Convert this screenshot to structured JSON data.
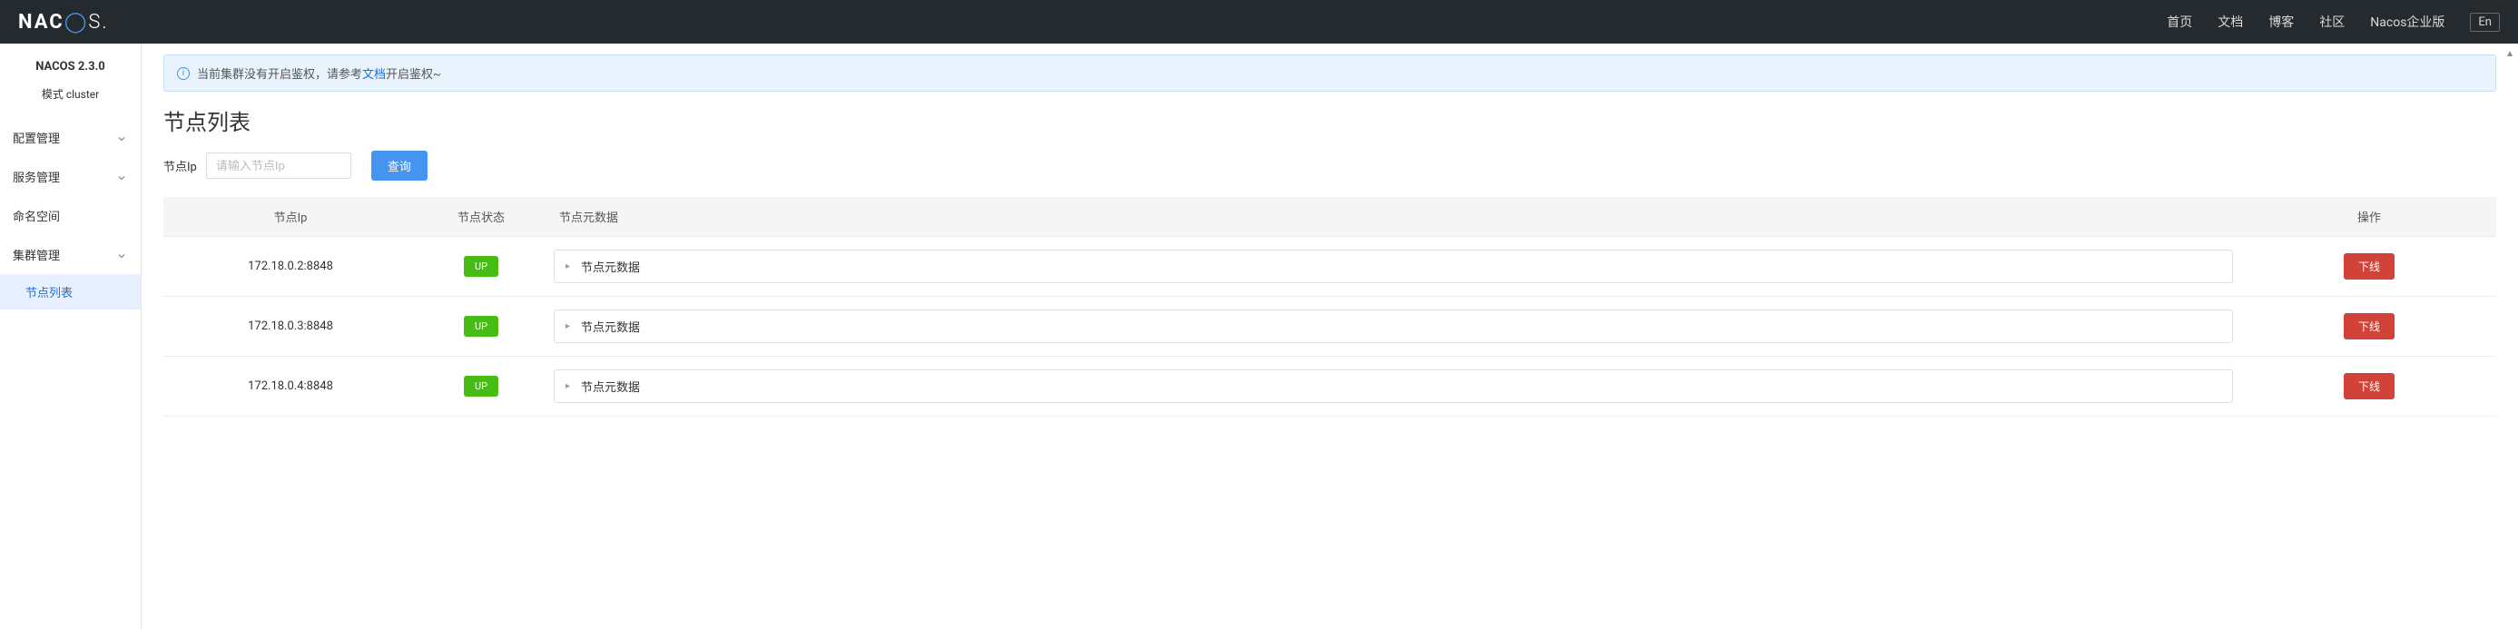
{
  "header": {
    "logo": "NACOS.",
    "nav": {
      "home": "首页",
      "docs": "文档",
      "blog": "博客",
      "community": "社区",
      "enterprise": "Nacos企业版",
      "lang": "En"
    }
  },
  "sidebar": {
    "version": "NACOS 2.3.0",
    "mode_label": "模式",
    "mode_value": "cluster",
    "menu": {
      "config": "配置管理",
      "service": "服务管理",
      "namespace": "命名空间",
      "cluster": "集群管理",
      "node_list": "节点列表"
    }
  },
  "alert": {
    "prefix": "当前集群没有开启鉴权，请参考",
    "link": "文档",
    "suffix": "开启鉴权~"
  },
  "page": {
    "title": "节点列表",
    "search_label": "节点Ip",
    "search_placeholder": "请输入节点Ip",
    "query_btn": "查询"
  },
  "table": {
    "headers": {
      "ip": "节点Ip",
      "status": "节点状态",
      "meta": "节点元数据",
      "action": "操作"
    },
    "status_up": "UP",
    "meta_label": "节点元数据",
    "offline_btn": "下线",
    "rows": [
      {
        "ip": "172.18.0.2:8848"
      },
      {
        "ip": "172.18.0.3:8848"
      },
      {
        "ip": "172.18.0.4:8848"
      }
    ]
  }
}
